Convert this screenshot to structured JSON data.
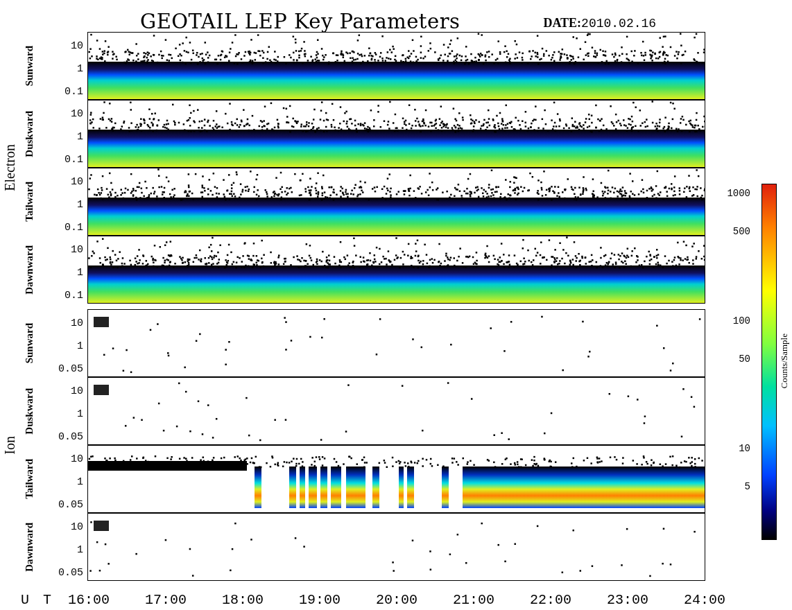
{
  "title": "GEOTAIL LEP Key Parameters",
  "date": {
    "label": "DATE:",
    "value": "2010.02.16"
  },
  "groups": [
    {
      "label": "Electron",
      "panels": [
        {
          "label": "Sunward",
          "kind": "band",
          "yticks": [
            "10",
            "1",
            "0.1"
          ]
        },
        {
          "label": "Duskward",
          "kind": "band",
          "yticks": [
            "10",
            "1",
            "0.1"
          ]
        },
        {
          "label": "Tailward",
          "kind": "band",
          "yticks": [
            "10",
            "1",
            "0.1"
          ]
        },
        {
          "label": "Dawnward",
          "kind": "band",
          "yticks": [
            "10",
            "1",
            "0.1"
          ]
        }
      ]
    },
    {
      "label": "Ion",
      "panels": [
        {
          "label": "Sunward",
          "kind": "sparse",
          "yticks": [
            "10",
            "1",
            "0.05"
          ]
        },
        {
          "label": "Duskward",
          "kind": "sparse",
          "yticks": [
            "10",
            "1",
            "0.05"
          ]
        },
        {
          "label": "Tailward",
          "kind": "gapped",
          "yticks": [
            "10",
            "1",
            "0.05"
          ]
        },
        {
          "label": "Dawnward",
          "kind": "sparse",
          "yticks": [
            "10",
            "1",
            "0.05"
          ]
        }
      ]
    }
  ],
  "xaxis": {
    "label": "U T",
    "ticks": [
      "16:00",
      "17:00",
      "18:00",
      "19:00",
      "20:00",
      "21:00",
      "22:00",
      "23:00",
      "24:00"
    ]
  },
  "colorbar": {
    "label": "Counts/Sample",
    "ticks": [
      "1000",
      "500",
      "100",
      "50",
      "10",
      "5"
    ]
  }
}
